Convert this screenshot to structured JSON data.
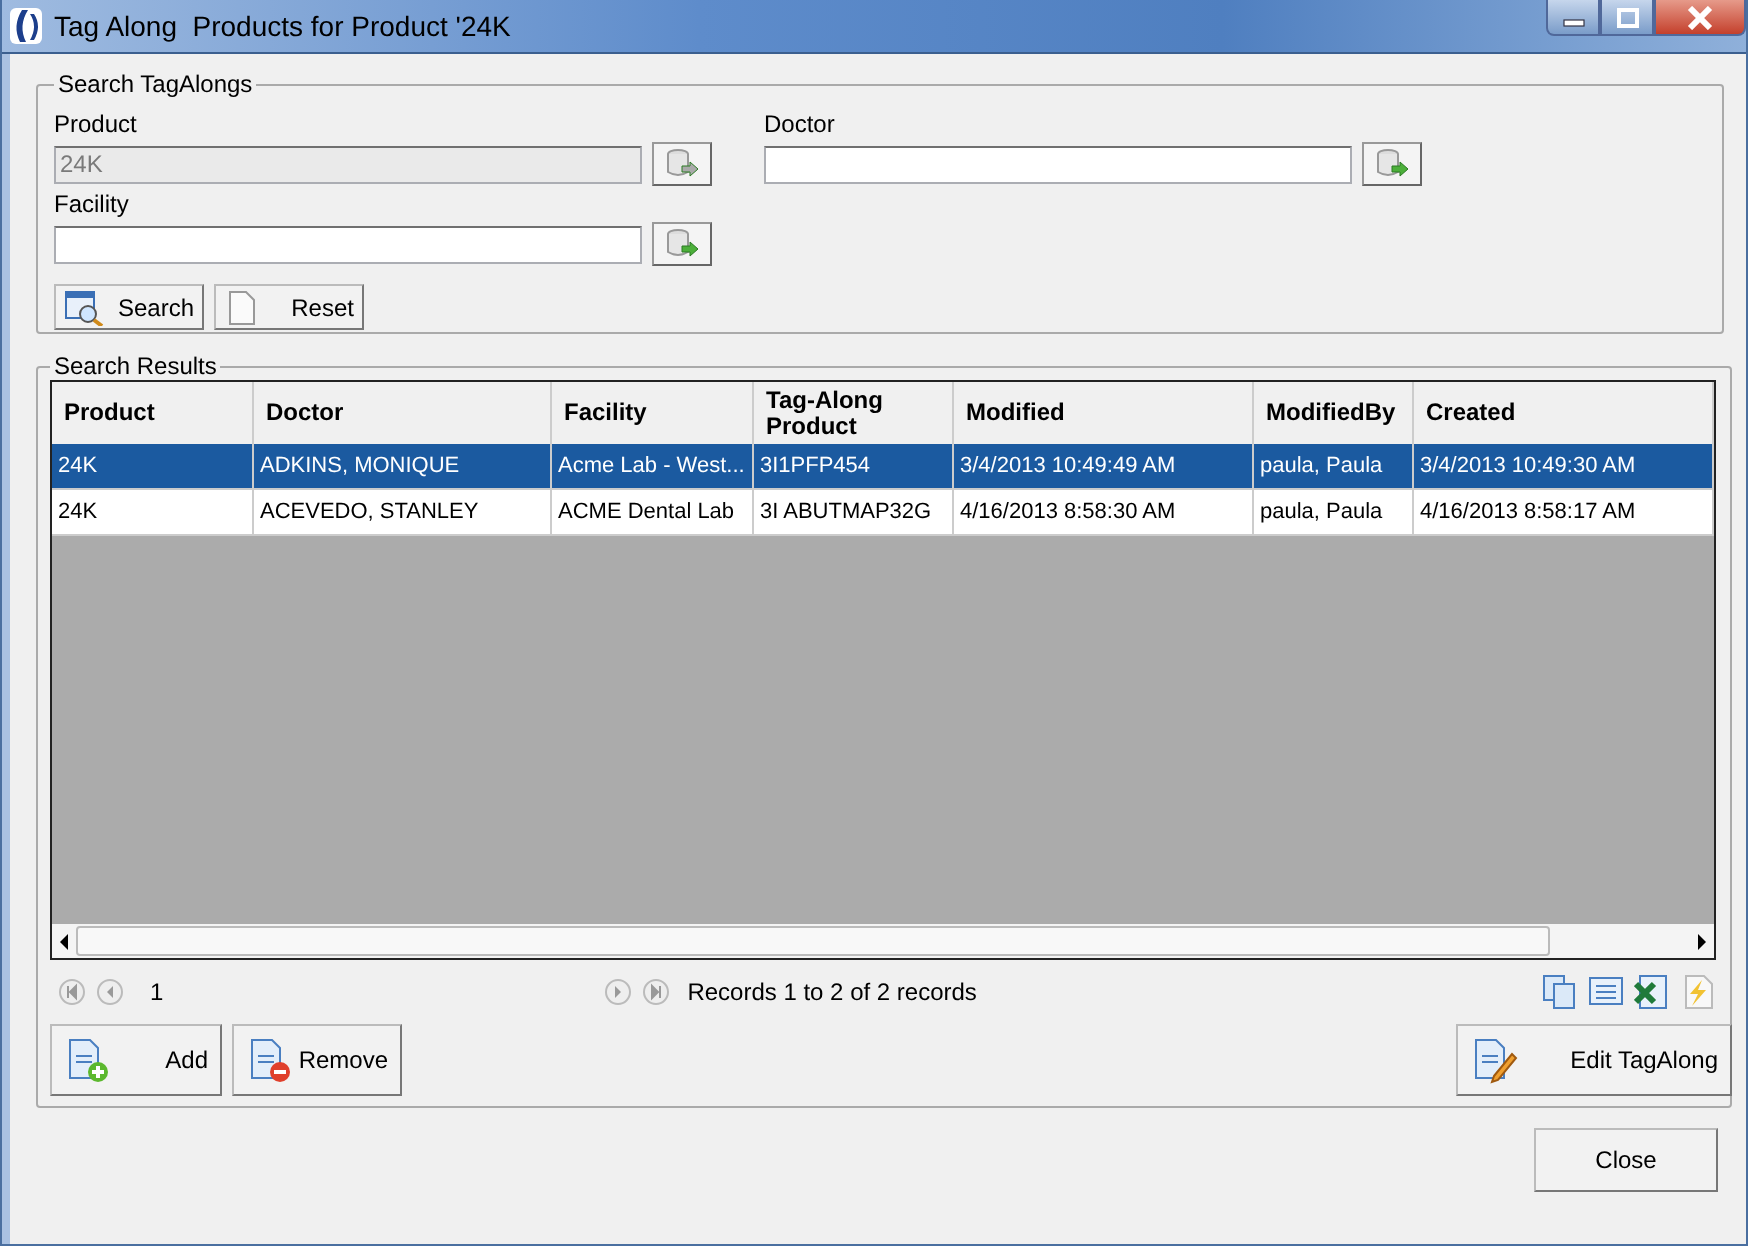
{
  "window": {
    "title": "Tag Along  Products for Product '24K"
  },
  "search_group": {
    "title": "Search TagAlongs",
    "fields": [
      {
        "label": "Product",
        "value": "24K",
        "disabled": true
      },
      {
        "label": "Doctor",
        "disabled": false
      },
      {
        "label": "Facility",
        "disabled": false
      }
    ],
    "buttons": [
      {
        "kind": "search",
        "label": "Search"
      },
      {
        "kind": "reset",
        "label": "Reset"
      }
    ]
  },
  "results_group": {
    "title": "Search Results",
    "table": {
      "columns": [
        "Product",
        "Doctor",
        "Facility",
        "Tag-Along Product",
        "Modified",
        "ModifiedBy",
        "Created"
      ],
      "rows": [
        {
          "selected": true,
          "cells": [
            "24K",
            "ADKINS, MONIQUE",
            "Acme Lab - West...",
            "3I1PFP454",
            "3/4/2013 10:49:49 AM",
            "paula, Paula",
            "3/4/2013 10:49:30 AM"
          ]
        },
        {
          "selected": false,
          "cells": [
            "24K",
            "ACEVEDO, STANLEY",
            "ACME Dental Lab",
            "3I ABUTMAP32G",
            "4/16/2013 8:58:30 AM",
            "paula, Paula",
            "4/16/2013 8:58:17 AM"
          ]
        }
      ]
    },
    "pager": {
      "page": "1",
      "summary": "Records 1 to 2 of 2 records"
    },
    "buttons": [
      {
        "kind": "add",
        "label": "Add"
      },
      {
        "kind": "remove",
        "label": "Remove"
      },
      {
        "kind": "edit",
        "label": "Edit TagAlong"
      }
    ]
  },
  "close_button": "Close"
}
